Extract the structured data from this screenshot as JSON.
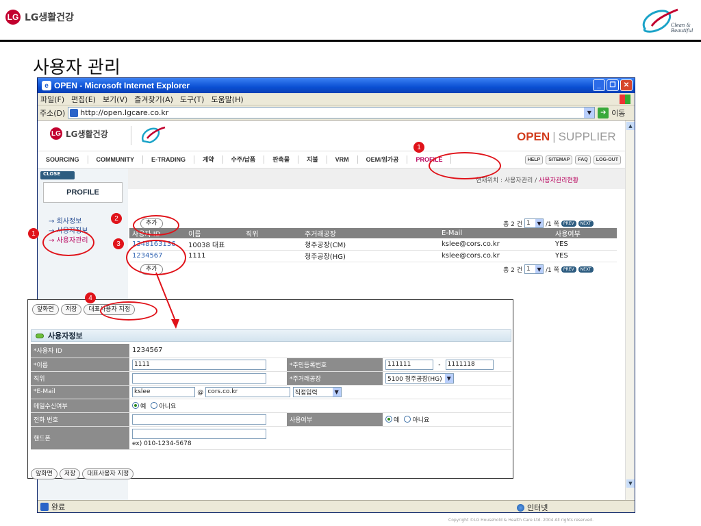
{
  "slide": {
    "logo_mark": "LG",
    "logo_text": "LG생활건강",
    "title": "사용자 관리",
    "clean_line1": "Clean &",
    "clean_line2": "Beautiful"
  },
  "browser": {
    "title": "OPEN - Microsoft Internet Explorer",
    "menu": [
      "파일(F)",
      "편집(E)",
      "보기(V)",
      "즐겨찾기(A)",
      "도구(T)",
      "도움말(H)"
    ],
    "address_label": "주소(D)",
    "url": "http://open.lgcare.co.kr",
    "go_label": "이동",
    "status_text": "완료",
    "zone_text": "인터넷"
  },
  "site": {
    "logo_text": "LG생활건강",
    "brand_open": "OPEN",
    "brand_supplier": "SUPPLIER",
    "nav": [
      "SOURCING",
      "COMMUNITY",
      "E-TRADING",
      "계약",
      "수주/납품",
      "판촉물",
      "지불",
      "VRM",
      "OEM/임가공",
      "PROFILE"
    ],
    "util": [
      "HELP",
      "SITEMAP",
      "FAQ",
      "LOG-OUT"
    ],
    "close_label": "CLOSE",
    "side_title": "PROFILE",
    "side_links": [
      "회사정보",
      "사용자정보",
      "사용자관리"
    ],
    "location_prefix": "현재위치 : 사용자관리 / ",
    "location_current": "사용자관리현황",
    "add_label": "추가",
    "pager": {
      "total": "총 2 건",
      "page": "1",
      "of": "/1 쪽",
      "prev": "PREV",
      "next": "NEXT"
    },
    "table_headers": [
      "사용자 ID",
      "이름",
      "직위",
      "주거래공장",
      "E-Mail",
      "사용여부"
    ],
    "rows": [
      [
        "1348163136",
        "10038 대표",
        "",
        "청주공장(CM)",
        "kslee@cors.co.kr",
        "YES"
      ],
      [
        "1234567",
        "1111",
        "",
        "청주공장(HG)",
        "kslee@cors.co.kr",
        "YES"
      ]
    ],
    "copyright": "Copyright ©LG Household & Health Care Ltd. 2004 All rights reserved."
  },
  "detail": {
    "buttons": [
      "앞화면",
      "저장",
      "대표사용자 지정"
    ],
    "section_title": "사용자정보",
    "labels": {
      "user_id": "*사용자 ID",
      "name": "*이름",
      "position": "직위",
      "email": "*E-Mail",
      "mail_recv": "메일수신여부",
      "phone": "전화 번호",
      "mobile": "핸드폰",
      "resident_no": "*주민등록번호",
      "main_factory": "*주거래공장",
      "use_yn": "사용여부"
    },
    "values": {
      "user_id": "1234567",
      "name": "1111",
      "position": "",
      "email_id": "kslee",
      "email_at": "@",
      "email_domain": "cors.co.kr",
      "email_select": "직접입력",
      "resident_1": "111111",
      "resident_dash": "-",
      "resident_2": "1111118",
      "main_factory": "5100 청주공장(HG)",
      "phone": "",
      "mobile": "",
      "mobile_hint": "ex) 010-1234-5678"
    },
    "radio_yes": "예",
    "radio_no": "아니요"
  },
  "annotations": {
    "n1": "1",
    "n2": "2",
    "n3": "3",
    "n4": "4"
  },
  "colors": {
    "annotation": "#e0131a",
    "brand_red": "#c2002f",
    "active_nav": "#b8005c"
  }
}
